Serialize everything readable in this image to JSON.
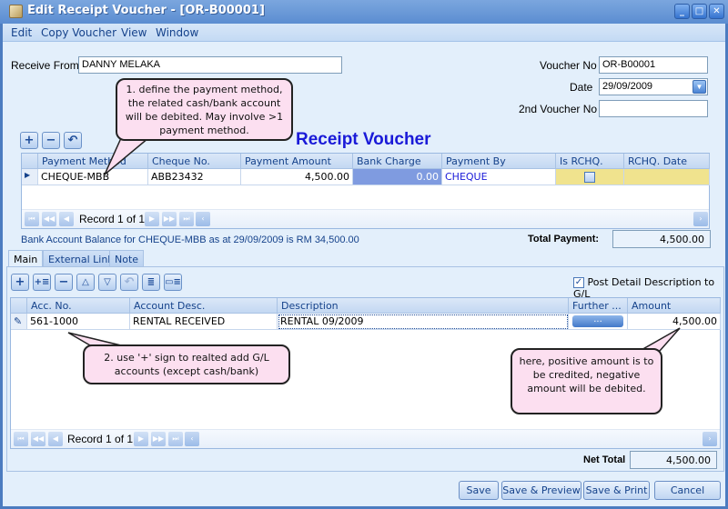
{
  "window": {
    "title": "Edit Receipt Voucher - [OR-B00001]",
    "controls": [
      "minimize",
      "maximize",
      "close"
    ]
  },
  "menu": [
    "Edit",
    "Copy Voucher",
    "View",
    "Window"
  ],
  "header": {
    "receive_from_label": "Receive From",
    "receive_from_value": "DANNY MELAKA",
    "voucher_no_label": "Voucher No",
    "voucher_no_value": "OR-B00001",
    "date_label": "Date",
    "date_value": "29/09/2009",
    "second_voucher_label": "2nd Voucher No",
    "second_voucher_value": ""
  },
  "heading": "Receipt Voucher",
  "payment_grid": {
    "columns": [
      "Payment Method",
      "Cheque No.",
      "Payment Amount",
      "Bank Charge",
      "Payment By",
      "Is RCHQ.",
      "RCHQ. Date"
    ],
    "rows": [
      {
        "payment_method": "CHEQUE-MBB",
        "cheque_no": "ABB23432",
        "payment_amount": "4,500.00",
        "bank_charge": "0.00",
        "payment_by": "CHEQUE",
        "is_rchq": false,
        "rchq_date": ""
      }
    ],
    "record_text": "Record 1 of 1"
  },
  "bank_balance_text": "Bank Account Balance for CHEQUE-MBB as at 29/09/2009 is RM 34,500.00",
  "total_payment": {
    "label": "Total Payment:",
    "value": "4,500.00"
  },
  "tabs": [
    "Main",
    "External Link",
    "Note"
  ],
  "post_detail": {
    "label": "Post Detail Description to G/L",
    "checked": true
  },
  "detail_grid": {
    "columns": [
      "Acc. No.",
      "Account Desc.",
      "Description",
      "Further ...",
      "Amount"
    ],
    "rows": [
      {
        "acc_no": "561-1000",
        "account_desc": "RENTAL RECEIVED",
        "description": "RENTAL 09/2009",
        "further": "...",
        "amount": "4,500.00"
      }
    ],
    "record_text": "Record 1 of 1"
  },
  "net_total": {
    "label": "Net Total",
    "value": "4,500.00"
  },
  "buttons": {
    "save": "Save",
    "save_preview": "Save & Preview",
    "save_print": "Save & Print",
    "cancel": "Cancel"
  },
  "callouts": {
    "c1": "1. define the payment method, the related cash/bank account will be debited. May involve >1 payment method.",
    "c2": "2. use '+' sign to realted add G/L accounts (except cash/bank)",
    "c3": "here, positive amount is to be credited, negative amount will be debited."
  },
  "colors": {
    "heading": "#1a1ad8",
    "bank_charge_cell": "#7f9be0",
    "rchq_cell": "#f0e38e",
    "callout_bg": "#fcdff0"
  }
}
